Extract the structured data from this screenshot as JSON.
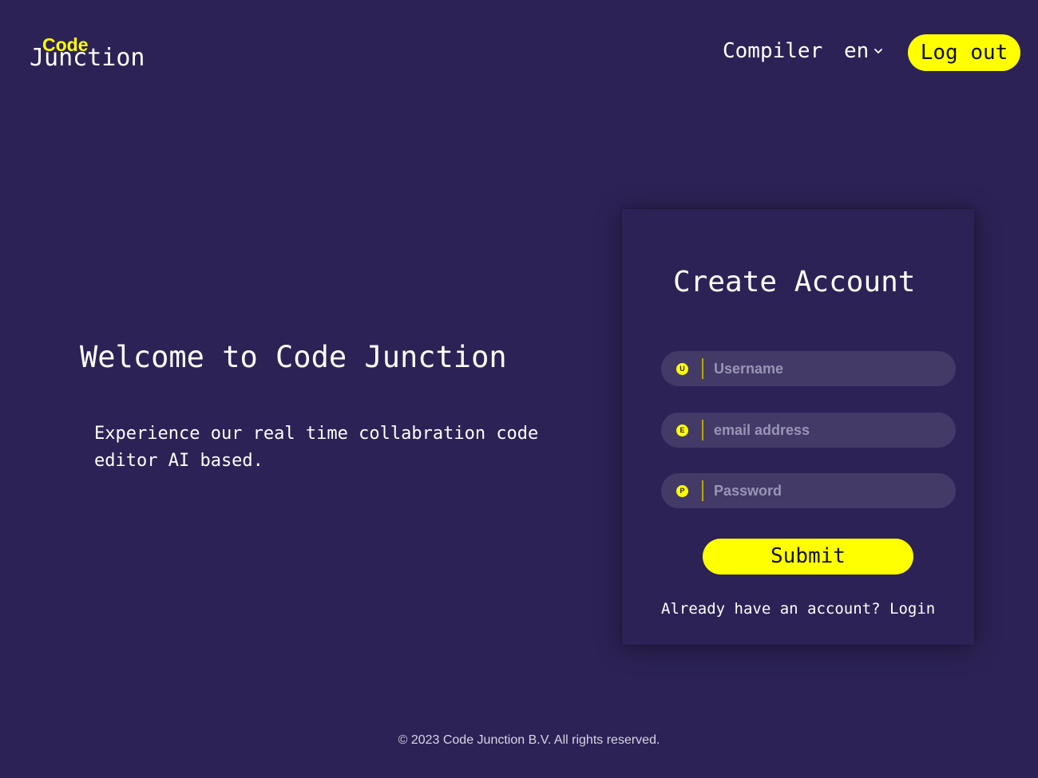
{
  "header": {
    "logo_code": "Code",
    "logo_junction": "Junction",
    "nav_compiler": "Compiler",
    "language": "en",
    "logout_label": "Log out"
  },
  "hero": {
    "title": "Welcome to Code Junction",
    "text": "Experience our real time collabration code editor AI based."
  },
  "signup": {
    "title": "Create Account",
    "fields": [
      {
        "icon_letter": "U",
        "icon": "user-icon",
        "placeholder": "Username",
        "value": ""
      },
      {
        "icon_letter": "E",
        "icon": "email-icon",
        "placeholder": "email address",
        "value": ""
      },
      {
        "icon_letter": "P",
        "icon": "password-icon",
        "placeholder": "Password",
        "value": ""
      }
    ],
    "submit_label": "Submit",
    "login_prompt": "Already have an account?",
    "login_link": "Login"
  },
  "footer": {
    "copyright": "© 2023 Code Junction B.V. All rights reserved."
  },
  "colors": {
    "background": "#2c2255",
    "accent": "#ffff00",
    "field_background": "#433a68"
  }
}
